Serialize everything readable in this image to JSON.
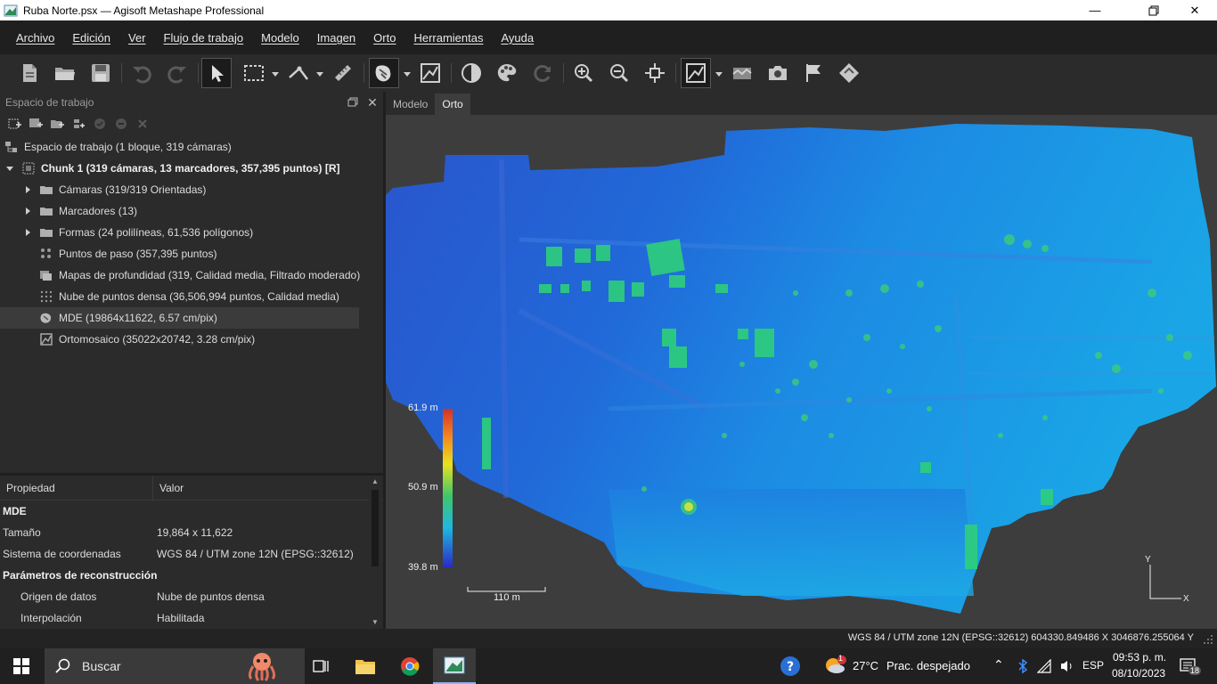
{
  "window": {
    "title": "Ruba Norte.psx — Agisoft Metashape Professional"
  },
  "menu": {
    "items": [
      "Archivo",
      "Edición",
      "Ver",
      "Flujo de trabajo",
      "Modelo",
      "Imagen",
      "Orto",
      "Herramientas",
      "Ayuda"
    ]
  },
  "workspace": {
    "header": "Espacio de trabajo",
    "root": "Espacio de trabajo (1 bloque, 319 cámaras)",
    "chunk": "Chunk 1 (319 cámaras, 13 marcadores, 357,395 puntos) [R]",
    "items": [
      "Cámaras (319/319 Orientadas)",
      "Marcadores (13)",
      "Formas (24 polilíneas, 61,536 polígonos)",
      "Puntos de paso (357,395 puntos)",
      "Mapas de profundidad (319, Calidad media, Filtrado moderado)",
      "Nube de puntos densa (36,506,994 puntos, Calidad media)",
      "MDE (19864x11622, 6.57 cm/pix)",
      "Ortomosaico (35022x20742, 3.28 cm/pix)"
    ]
  },
  "properties": {
    "col_property": "Propiedad",
    "col_value": "Valor",
    "section_main": "MDE",
    "size_key": "Tamaño",
    "size_value": "19,864 x 11,622",
    "crs_key": "Sistema de coordenadas",
    "crs_value": "WGS 84 / UTM zone 12N (EPSG::32612)",
    "section_recon": "Parámetros de reconstrucción",
    "source_key": "Origen de datos",
    "source_value": "Nube de puntos densa",
    "interp_key": "Interpolación",
    "interp_value": "Habilitada"
  },
  "viewport": {
    "tabs": [
      "Modelo",
      "Orto"
    ],
    "active_tab": "Orto",
    "legend_max": "61.9 m",
    "legend_mid": "50.9 m",
    "legend_min": "39.8 m",
    "scale": "110 m",
    "axis_y": "Y",
    "axis_x": "X"
  },
  "statusbar": {
    "coords": "WGS 84 / UTM zone 12N (EPSG::32612)   604330.849486 X   3046876.255064 Y"
  },
  "taskbar": {
    "search_placeholder": "Buscar",
    "weather_badge": "1",
    "temperature": "27°C",
    "weather": "Prac. despejado",
    "language": "ESP",
    "time": "09:53 p. m.",
    "date": "08/10/2023",
    "notifications": "18"
  },
  "colors": {
    "accent": "#2e8bff",
    "panel": "#2b2b2b",
    "viewport": "#3d3d3d",
    "dem_low": "#2a52c8",
    "dem_mid": "#1fb8e0",
    "dem_high": "#3ec76a"
  },
  "icons": {
    "toolbar": [
      "new-icon",
      "open-icon",
      "save-icon",
      "undo-icon",
      "redo-icon",
      "select-icon",
      "rect-select-icon",
      "ruler-icon",
      "measure-icon",
      "dem-icon",
      "ortho-edit-icon",
      "contrast-icon",
      "palette-icon",
      "rotate-icon",
      "zoom-in-icon",
      "zoom-out-icon",
      "fit-icon",
      "view-mode-icon",
      "shapes-icon",
      "camera-icon",
      "flag-icon",
      "marker-icon"
    ]
  }
}
